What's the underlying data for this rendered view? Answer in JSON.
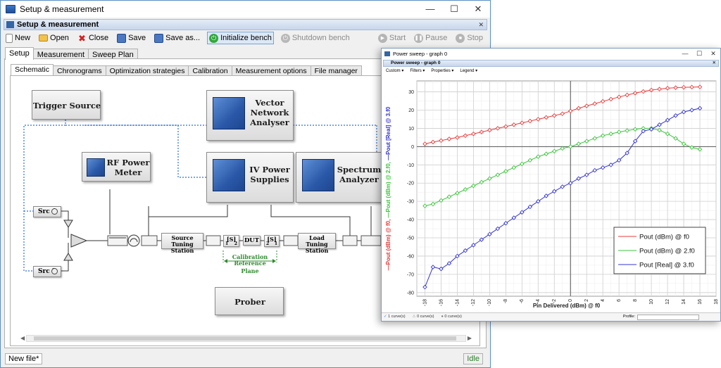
{
  "main_window": {
    "title": "Setup & measurement",
    "controls": {
      "minimize": "—",
      "maximize": "☐",
      "close": "✕"
    },
    "subheader": "Setup & measurement",
    "toolbar": {
      "new": "New",
      "open": "Open",
      "close": "Close",
      "save": "Save",
      "save_as": "Save as...",
      "initialize": "Initialize bench",
      "shutdown": "Shutdown bench",
      "start": "Start",
      "pause": "Pause",
      "stop": "Stop"
    },
    "tabs": [
      "Setup",
      "Measurement",
      "Sweep Plan"
    ],
    "subtabs": [
      "Schematic",
      "Chronograms",
      "Optimization strategies",
      "Calibration",
      "Measurement options",
      "File manager"
    ],
    "schematic": {
      "trigger": "Trigger Source",
      "vna": [
        "Vector",
        "Network",
        "Analyser"
      ],
      "rf_meter": [
        "RF Power",
        "Meter"
      ],
      "iv": [
        "IV Power",
        "Supplies"
      ],
      "spectrum": [
        "Spectrum",
        "Analyzer"
      ],
      "src1": "Src 1",
      "src2": "Src 2",
      "source_tuning": [
        "Source Tuning",
        "Station"
      ],
      "load_tuning": [
        "Load Tuning",
        "Station"
      ],
      "dut": "DUT",
      "s_block": "[S]",
      "port1": "1",
      "port2": "2",
      "calib": [
        "Calibration Reference",
        "Plane"
      ],
      "prober": "Prober"
    },
    "status": {
      "file": "New file*",
      "state": "Idle"
    }
  },
  "graph_window": {
    "title": "Power sweep - graph 0",
    "subheader": "Power sweep - graph 0",
    "menu": [
      "Custom ▾",
      "Filters ▾",
      "Properties ▾",
      "Legend ▾"
    ],
    "status": {
      "curves1": "1 curve(s)",
      "curves2": "0 curve(s)",
      "curves3": "0 curve(s)",
      "profile": "Profile:"
    }
  },
  "chart_data": {
    "type": "line",
    "xlabel": "Pin Delivered (dBm) @ f0",
    "ylabel_parts": [
      {
        "text": "Pout (dBm) @ f0,",
        "color": "#e53b3b"
      },
      {
        "text": "Pout (dBm) @ 2.f0,",
        "color": "#3cc43c"
      },
      {
        "text": "Pout [Real] @ 3.f0",
        "color": "#3535d0"
      }
    ],
    "xlim": [
      -19,
      18
    ],
    "ylim": [
      -82,
      36
    ],
    "xticks": [
      -18,
      -16,
      -14,
      -12,
      -10,
      -8,
      -6,
      -4,
      -2,
      0,
      2,
      4,
      6,
      8,
      10,
      12,
      14,
      16,
      18
    ],
    "yticks": [
      -80,
      -70,
      -60,
      -50,
      -40,
      -30,
      -20,
      -10,
      0,
      10,
      20,
      30
    ],
    "grid": true,
    "legend_position": "bottom-right",
    "series": [
      {
        "name": "Pout (dBm) @ f0",
        "color": "#e53b3b",
        "x": [
          -18,
          -17,
          -16,
          -15,
          -14,
          -13,
          -12,
          -11,
          -10,
          -9,
          -8,
          -7,
          -6,
          -5,
          -4,
          -3,
          -2,
          -1,
          0,
          1,
          2,
          3,
          4,
          5,
          6,
          7,
          8,
          9,
          10,
          11,
          12,
          13,
          14,
          15,
          16
        ],
        "values": [
          1.5,
          2.5,
          3.3,
          4.2,
          5.0,
          6.0,
          7.0,
          8.0,
          9.0,
          10.0,
          11.0,
          12.0,
          13.0,
          14.0,
          15.0,
          16.0,
          17.0,
          18.0,
          19.5,
          21.0,
          22.3,
          23.5,
          24.8,
          26.0,
          27.2,
          28.3,
          29.3,
          30.2,
          31.0,
          31.5,
          32.0,
          32.3,
          32.5,
          32.6,
          32.7
        ]
      },
      {
        "name": "Pout (dBm) @ 2.f0",
        "color": "#3cc43c",
        "x": [
          -18,
          -17,
          -16,
          -15,
          -14,
          -13,
          -12,
          -11,
          -10,
          -9,
          -8,
          -7,
          -6,
          -5,
          -4,
          -3,
          -2,
          -1,
          0,
          1,
          2,
          3,
          4,
          5,
          6,
          7,
          8,
          9,
          10,
          11,
          12,
          13,
          14,
          15,
          16
        ],
        "values": [
          -32.5,
          -31.5,
          -29.5,
          -27.5,
          -25.5,
          -23.5,
          -21.5,
          -19.5,
          -17.5,
          -15.5,
          -13.5,
          -11.5,
          -9.5,
          -7.5,
          -5.5,
          -4.0,
          -2.5,
          -1.0,
          0.0,
          1.5,
          3.0,
          4.5,
          6.0,
          7.0,
          8.0,
          8.8,
          9.5,
          10.0,
          10.0,
          9.0,
          7.0,
          4.5,
          1.5,
          -0.5,
          -1.5
        ]
      },
      {
        "name": "Pout [Real] @ 3.f0",
        "color": "#3535d0",
        "x": [
          -18,
          -17,
          -16,
          -15,
          -14,
          -13,
          -12,
          -11,
          -10,
          -9,
          -8,
          -7,
          -6,
          -5,
          -4,
          -3,
          -2,
          -1,
          0,
          1,
          2,
          3,
          4,
          5,
          6,
          7,
          8,
          9,
          10,
          11,
          12,
          13,
          14,
          15,
          16
        ],
        "values": [
          -77.0,
          -66.0,
          -67.0,
          -64.0,
          -60.0,
          -57.0,
          -54.0,
          -51.0,
          -48.0,
          -45.0,
          -42.0,
          -39.0,
          -36.0,
          -33.0,
          -30.0,
          -27.0,
          -24.5,
          -22.0,
          -20.0,
          -17.5,
          -15.5,
          -13.0,
          -11.5,
          -10.0,
          -7.5,
          -3.5,
          3.0,
          8.5,
          9.5,
          12.0,
          14.5,
          17.0,
          19.0,
          20.0,
          21.0
        ]
      }
    ]
  }
}
